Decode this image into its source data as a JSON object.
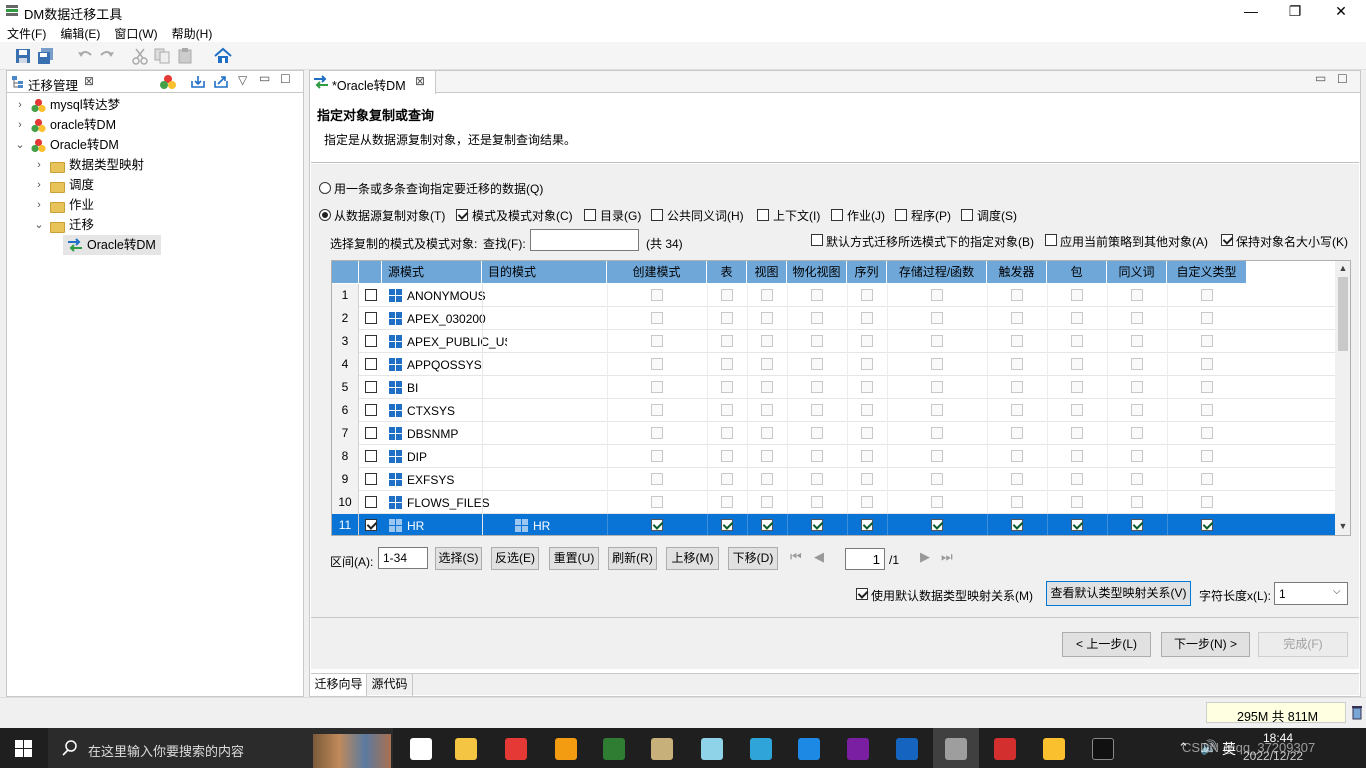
{
  "window": {
    "title": "DM数据迁移工具",
    "min": "—",
    "max": "❐",
    "close": "✕"
  },
  "menu": [
    "文件(F)",
    "编辑(E)",
    "窗口(W)",
    "帮助(H)"
  ],
  "left_panel": {
    "tab_title": "迁移管理",
    "tree": [
      {
        "label": "mysql转达梦",
        "level": 0,
        "arrow": "›",
        "icon": "db-icon"
      },
      {
        "label": "oracle转DM",
        "level": 0,
        "arrow": "›",
        "icon": "db-icon"
      },
      {
        "label": "Oracle转DM",
        "level": 0,
        "arrow": "⌄",
        "icon": "db-icon"
      },
      {
        "label": "数据类型映射",
        "level": 1,
        "arrow": "›",
        "icon": "folder-icon"
      },
      {
        "label": "调度",
        "level": 1,
        "arrow": "›",
        "icon": "folder-icon"
      },
      {
        "label": "作业",
        "level": 1,
        "arrow": "›",
        "icon": "folder-icon"
      },
      {
        "label": "迁移",
        "level": 1,
        "arrow": "⌄",
        "icon": "folder-icon"
      },
      {
        "label": "Oracle转DM",
        "level": 2,
        "arrow": "",
        "icon": "migrate-icon"
      }
    ]
  },
  "editor": {
    "tab_title": "*Oracle转DM",
    "header_title": "指定对象复制或查询",
    "header_desc": "指定是从数据源复制对象，还是复制查询结果。",
    "opt_query": "用一条或多条查询指定要迁移的数据(Q)",
    "opt_copy": "从数据源复制对象(T)",
    "filters": [
      {
        "label": "模式及模式对象(C)",
        "checked": true
      },
      {
        "label": "目录(G)",
        "checked": false
      },
      {
        "label": "公共同义词(H)",
        "checked": false
      },
      {
        "label": "上下文(I)",
        "checked": false
      },
      {
        "label": "作业(J)",
        "checked": false
      },
      {
        "label": "程序(P)",
        "checked": false
      },
      {
        "label": "调度(S)",
        "checked": false
      }
    ],
    "select_label": "选择复制的模式及模式对象:",
    "find_label": "查找(F):",
    "find_value": "",
    "total": "(共 34)",
    "opt_default_migrate": "默认方式迁移所选模式下的指定对象(B)",
    "opt_apply_policy": "应用当前策略到其他对象(A)",
    "opt_keep_case": "保持对象名大小写(K)",
    "columns": [
      "源模式",
      "目的模式",
      "创建模式",
      "表",
      "视图",
      "物化视图",
      "序列",
      "存储过程/函数",
      "触发器",
      "包",
      "同义词",
      "自定义类型"
    ],
    "rows": [
      {
        "n": "1",
        "src": "ANONYMOUS",
        "dst": "",
        "checked": false
      },
      {
        "n": "2",
        "src": "APEX_030200",
        "dst": "",
        "checked": false
      },
      {
        "n": "3",
        "src": "APEX_PUBLIC_US.",
        "dst": "",
        "checked": false
      },
      {
        "n": "4",
        "src": "APPQOSSYS",
        "dst": "",
        "checked": false
      },
      {
        "n": "5",
        "src": "BI",
        "dst": "",
        "checked": false
      },
      {
        "n": "6",
        "src": "CTXSYS",
        "dst": "",
        "checked": false
      },
      {
        "n": "7",
        "src": "DBSNMP",
        "dst": "",
        "checked": false
      },
      {
        "n": "8",
        "src": "DIP",
        "dst": "",
        "checked": false
      },
      {
        "n": "9",
        "src": "EXFSYS",
        "dst": "",
        "checked": false
      },
      {
        "n": "10",
        "src": "FLOWS_FILES",
        "dst": "",
        "checked": false
      },
      {
        "n": "11",
        "src": "HR",
        "dst": "HR",
        "checked": true
      }
    ],
    "range_label": "区间(A):",
    "range_value": "1-34",
    "btn_select": "选择(S)",
    "btn_invert": "反选(E)",
    "btn_reset": "重置(U)",
    "btn_refresh": "刷新(R)",
    "btn_up": "上移(M)",
    "btn_down": "下移(D)",
    "page_value": "1",
    "page_total": "/1",
    "opt_use_default_map": "使用默认数据类型映射关系(M)",
    "btn_view_map": "查看默认类型映射关系(V)",
    "char_len_label": "字符长度x(L):",
    "char_len_value": "1",
    "btn_prev": "< 上一步(L)",
    "btn_next": "下一步(N) >",
    "btn_finish": "完成(F)",
    "bottom_tabs": [
      "迁移向导",
      "源代码"
    ]
  },
  "status": {
    "memory": "295M 共 811M"
  },
  "taskbar": {
    "search_placeholder": "在这里输入你要搜索的内容",
    "ime": "英",
    "time": "18:44",
    "date": "2022/12/22",
    "watermark": "CSDN @qq_37209307"
  }
}
